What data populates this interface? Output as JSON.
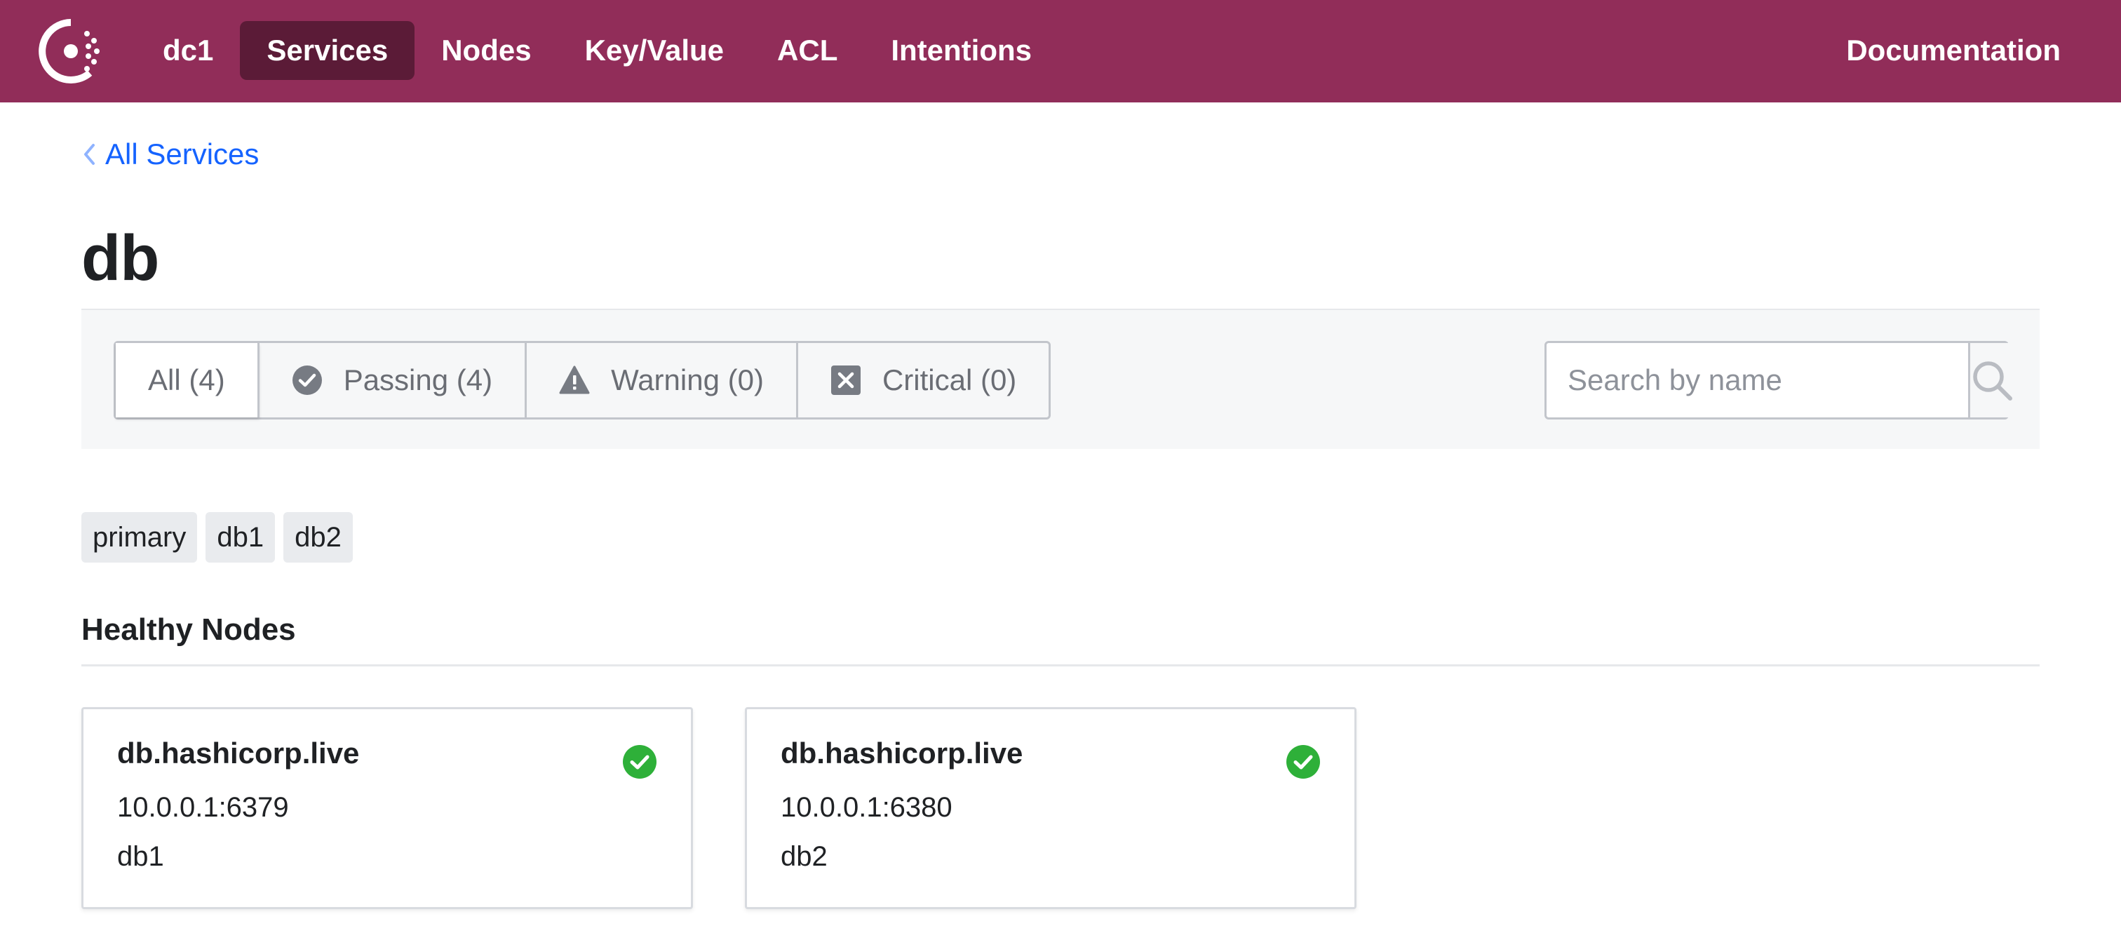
{
  "brand_color": "#912d59",
  "link_color": "#1563ff",
  "header": {
    "logo_icon": "consul-logo-icon",
    "datacenter": "dc1",
    "nav": [
      {
        "label": "Services",
        "active": true
      },
      {
        "label": "Nodes",
        "active": false
      },
      {
        "label": "Key/Value",
        "active": false
      },
      {
        "label": "ACL",
        "active": false
      },
      {
        "label": "Intentions",
        "active": false
      }
    ],
    "documentation": "Documentation"
  },
  "breadcrumb": {
    "label": "All Services",
    "icon": "chevron-left-icon"
  },
  "page": {
    "title": "db"
  },
  "filters": [
    {
      "label": "All (4)",
      "selected": true,
      "icon": null
    },
    {
      "label": "Passing (4)",
      "selected": false,
      "icon": "check-circle-icon"
    },
    {
      "label": "Warning (0)",
      "selected": false,
      "icon": "warning-triangle-icon"
    },
    {
      "label": "Critical (0)",
      "selected": false,
      "icon": "x-square-icon"
    }
  ],
  "search": {
    "placeholder": "Search by name",
    "value": "",
    "icon": "search-icon"
  },
  "tags": [
    "primary",
    "db1",
    "db2"
  ],
  "healthy_nodes": {
    "title": "Healthy Nodes",
    "nodes": [
      {
        "name": "db.hashicorp.live",
        "address": "10.0.0.1:6379",
        "node": "db1",
        "status": "passing",
        "status_color": "#2eb039"
      },
      {
        "name": "db.hashicorp.live",
        "address": "10.0.0.1:6380",
        "node": "db2",
        "status": "passing",
        "status_color": "#2eb039"
      }
    ]
  }
}
